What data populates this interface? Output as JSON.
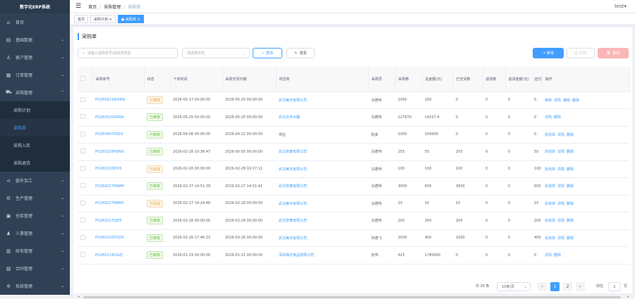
{
  "app": {
    "name": "数字化ERP系统"
  },
  "sidebar": {
    "items": [
      {
        "label": "首页",
        "icon": "home-icon"
      },
      {
        "label": "基础数据",
        "icon": "database-icon"
      },
      {
        "label": "客户管理",
        "icon": "user-icon"
      },
      {
        "label": "订单管理",
        "icon": "order-icon"
      },
      {
        "label": "采购管理",
        "icon": "cart-icon"
      }
    ],
    "sub_items": [
      {
        "label": "采购计划"
      },
      {
        "label": "采购单"
      },
      {
        "label": "采购入库"
      },
      {
        "label": "采购退货"
      }
    ],
    "items_after": [
      {
        "label": "委外加工",
        "icon": "share-icon"
      },
      {
        "label": "生产管理",
        "icon": "gear-icon"
      },
      {
        "label": "仓库管理",
        "icon": "warehouse-icon"
      },
      {
        "label": "人事管理",
        "icon": "person-icon"
      },
      {
        "label": "财务管理",
        "icon": "money-icon"
      },
      {
        "label": "合同管理",
        "icon": "contract-icon"
      },
      {
        "label": "系统管理",
        "icon": "settings-icon"
      }
    ]
  },
  "header": {
    "breadcrumb": [
      "首页",
      "采购管理",
      "采购单"
    ],
    "user": "test▾"
  },
  "tags": [
    {
      "label": "首页"
    },
    {
      "label": "采购计划 ×"
    },
    {
      "label": "● 采购单 ×"
    }
  ],
  "page": {
    "title": "采购单",
    "search_placeholder": "请输入采购单号/采购员姓名",
    "status_placeholder": "请选择状态",
    "query_label": "查询",
    "reset_label": "重置",
    "add_label": "+ 新增",
    "print_label": "打印",
    "delete_label": "删除"
  },
  "table": {
    "headers": [
      "采购单号",
      "状态",
      "下单时间",
      "采购交货日期",
      "供应商",
      "采购员",
      "采购数",
      "总金额(元)",
      "已交货数",
      "退货数",
      "退货金额(元)",
      "应付",
      "操作"
    ],
    "rows": [
      {
        "no": "PO260521WXRW",
        "status": "已审核",
        "sc": "orange",
        "order_time": "2026-05-17 00:00:00",
        "delivery": "2026-05-20 00:00:00",
        "supplier": "武汉美天有限公司",
        "sl": true,
        "buyer": "马德伟",
        "qty": "1000",
        "total": "200",
        "delivered": "0",
        "ret": "0",
        "ret_amt": "0",
        "pay": "0",
        "ops": [
          "审核",
          "详情",
          "编辑",
          "删除"
        ]
      },
      {
        "no": "PO260520GRRN",
        "status": "已审核",
        "sc": "green",
        "order_time": "2026-05-20 00:00:00",
        "delivery": "2026-05-20 00:00:00",
        "supplier": "武汉云丰木器",
        "sl": true,
        "buyer": "马德伟",
        "qty": "127970",
        "total": "14337.4",
        "delivered": "0",
        "ret": "0",
        "ret_amt": "0",
        "pay": "0",
        "ops": [
          "详情",
          "删除"
        ]
      },
      {
        "no": "PO260407SRD2",
        "status": "已审核",
        "sc": "green",
        "order_time": "2026-04-08 00:00:00",
        "delivery": "2026-04-22 00:00:00",
        "supplier": "供应",
        "sl": false,
        "buyer": "陈良",
        "qty": "1000",
        "total": "100000",
        "delivered": "0",
        "ret": "0",
        "ret_amt": "0",
        "pay": "0",
        "ops": [
          "反结单",
          "详情",
          "删除"
        ]
      },
      {
        "no": "PO260228PWNU",
        "status": "已审核",
        "sc": "green",
        "order_time": "2026-02-28 10:36:47",
        "delivery": "2026-05-05 00:00:00",
        "supplier": "武汉安泰有限公司",
        "sl": true,
        "buyer": "马德伟",
        "qty": "255",
        "total": "55",
        "delivered": "255",
        "ret": "0",
        "ret_amt": "0",
        "pay": "55",
        "ops": [
          "反结单",
          "详情",
          "删除"
        ]
      },
      {
        "no": "PO260228ZVIS",
        "status": "已完成",
        "sc": "orange",
        "order_time": "2026-02-28 00:00:00",
        "delivery": "2026-02-28 10:17:11",
        "supplier": "武汉美天有限公司",
        "sl": true,
        "buyer": "马德伟",
        "qty": "100",
        "total": "100",
        "delivered": "100",
        "ret": "0",
        "ret_amt": "0",
        "pay": "100",
        "ops": [
          "反结单",
          "详情",
          "删除"
        ]
      },
      {
        "no": "PO260227MAMP",
        "status": "已审核",
        "sc": "green",
        "order_time": "2026-02-27 14:51:39",
        "delivery": "2026-02-27 14:51:41",
        "supplier": "武汉安泰有限公司",
        "sl": true,
        "buyer": "马德伟",
        "qty": "3000",
        "total": "600",
        "delivered": "3000",
        "ret": "0",
        "ret_amt": "0",
        "pay": "600",
        "ops": [
          "反结单",
          "详情",
          "删除"
        ]
      },
      {
        "no": "PO260227NBBD",
        "status": "已完成",
        "sc": "orange",
        "order_time": "2026-02-27 14:24:48",
        "delivery": "2026-02-28 00:00:00",
        "supplier": "武汉美天有限公司",
        "sl": true,
        "buyer": "马德伟",
        "qty": "10",
        "total": "10",
        "delivered": "10",
        "ret": "0",
        "ret_amt": "0",
        "pay": "10",
        "ops": [
          "反结单",
          "详情",
          "删除"
        ]
      },
      {
        "no": "PO260227DJE5",
        "status": "已审核",
        "sc": "green",
        "order_time": "2026-02-28 00:00:00",
        "delivery": "2026-02-28 00:00:00",
        "supplier": "武汉安泰有限公司",
        "sl": true,
        "buyer": "马德伟",
        "qty": "200",
        "total": "200",
        "delivered": "200",
        "ret": "0",
        "ret_amt": "0",
        "pay": "200",
        "ops": [
          "反结单",
          "详情",
          "删除"
        ]
      },
      {
        "no": "PO260226TOO9",
        "status": "已审核",
        "sc": "green",
        "order_time": "2026-02-26 17:46:33",
        "delivery": "2026-03-26 00:00:00",
        "supplier": "武汉美天有限公司",
        "sl": true,
        "buyer": "孙德飞",
        "qty": "2000",
        "total": "400",
        "delivered": "2000",
        "ret": "0",
        "ret_amt": "0",
        "pay": "400",
        "ops": [
          "反结单",
          "详情",
          "删除"
        ]
      },
      {
        "no": "PO260119OGZJ",
        "status": "已审核",
        "sc": "green",
        "order_time": "2026-01-19 00:00:00",
        "delivery": "2026-01-21 00:00:00",
        "supplier": "深圳海洋食品有限公司",
        "sl": true,
        "buyer": "张伟",
        "qty": "425",
        "total": "1780000",
        "delivered": "0",
        "ret": "0",
        "ret_amt": "0",
        "pay": "0",
        "ops": [
          "详情",
          "删除"
        ]
      }
    ]
  },
  "pagination": {
    "total": "共 29 条",
    "page_size": "10条/页",
    "pages": [
      "1",
      "2"
    ],
    "goto_label": "前往",
    "goto_value": "1",
    "page_unit": "页",
    "prev": "‹",
    "next": "›"
  },
  "colors": {
    "sidebar": "#304156",
    "primary": "#409eff",
    "success": "#67c23a",
    "warning": "#e6a23c"
  }
}
